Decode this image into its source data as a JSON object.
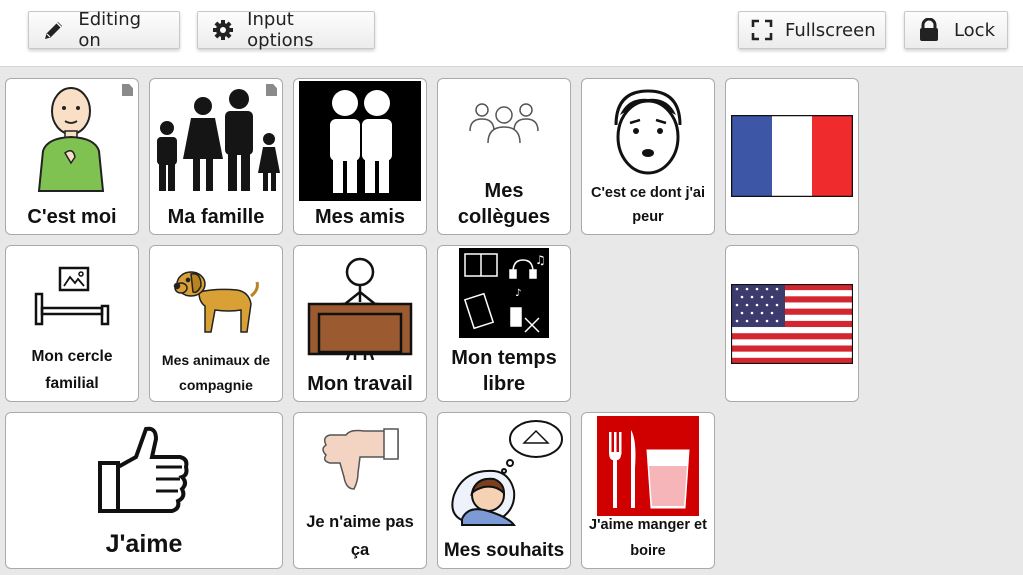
{
  "toolbar": {
    "editing_label": "Editing on",
    "input_options_label": "Input options",
    "fullscreen_label": "Fullscreen",
    "lock_label": "Lock"
  },
  "cells": {
    "c_est_moi": "C'est moi",
    "ma_famille": "Ma famille",
    "mes_amis": "Mes amis",
    "mes_collegues": "Mes collègues",
    "peur": "C'est ce dont j'ai peur",
    "cercle": "Mon cercle familial",
    "animaux": "Mes animaux de compagnie",
    "travail": "Mon travail",
    "temps_libre": "Mon temps libre",
    "j_aime": "J'aime",
    "je_n_aime_pas": "Je n'aime pas ça",
    "souhaits": "Mes souhaits",
    "manger": "J'aime manger et boire"
  },
  "icons": {
    "editing": "pencil-icon",
    "input_options": "gear-icon",
    "fullscreen": "fullscreen-icon",
    "lock": "lock-icon",
    "folder_marker": "folder-corner-icon"
  },
  "colors": {
    "toolbar_bg": "#ffffff",
    "grid_bg": "#e8e8e8",
    "cell_border": "#aaaaaa",
    "folder_marker": "#8a8a8a"
  }
}
